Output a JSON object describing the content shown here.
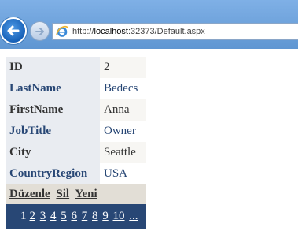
{
  "browser": {
    "url_prefix": "http://",
    "url_host": "localhost",
    "url_rest": ":32373/Default.aspx"
  },
  "record": [
    {
      "label": "ID",
      "value": "2"
    },
    {
      "label": "LastName",
      "value": "Bedecs"
    },
    {
      "label": "FirstName",
      "value": "Anna"
    },
    {
      "label": "JobTitle",
      "value": "Owner"
    },
    {
      "label": "City",
      "value": "Seattle"
    },
    {
      "label": "CountryRegion",
      "value": "USA"
    }
  ],
  "commands": {
    "edit": "Düzenle",
    "delete": "Sil",
    "new": "Yeni"
  },
  "pager": {
    "current": "1",
    "pages": [
      "2",
      "3",
      "4",
      "5",
      "6",
      "7",
      "8",
      "9",
      "10",
      "..."
    ]
  },
  "colors": {
    "header_text_alt": "#284775",
    "pager_bg": "#284775",
    "command_bg": "#e2ded6"
  }
}
